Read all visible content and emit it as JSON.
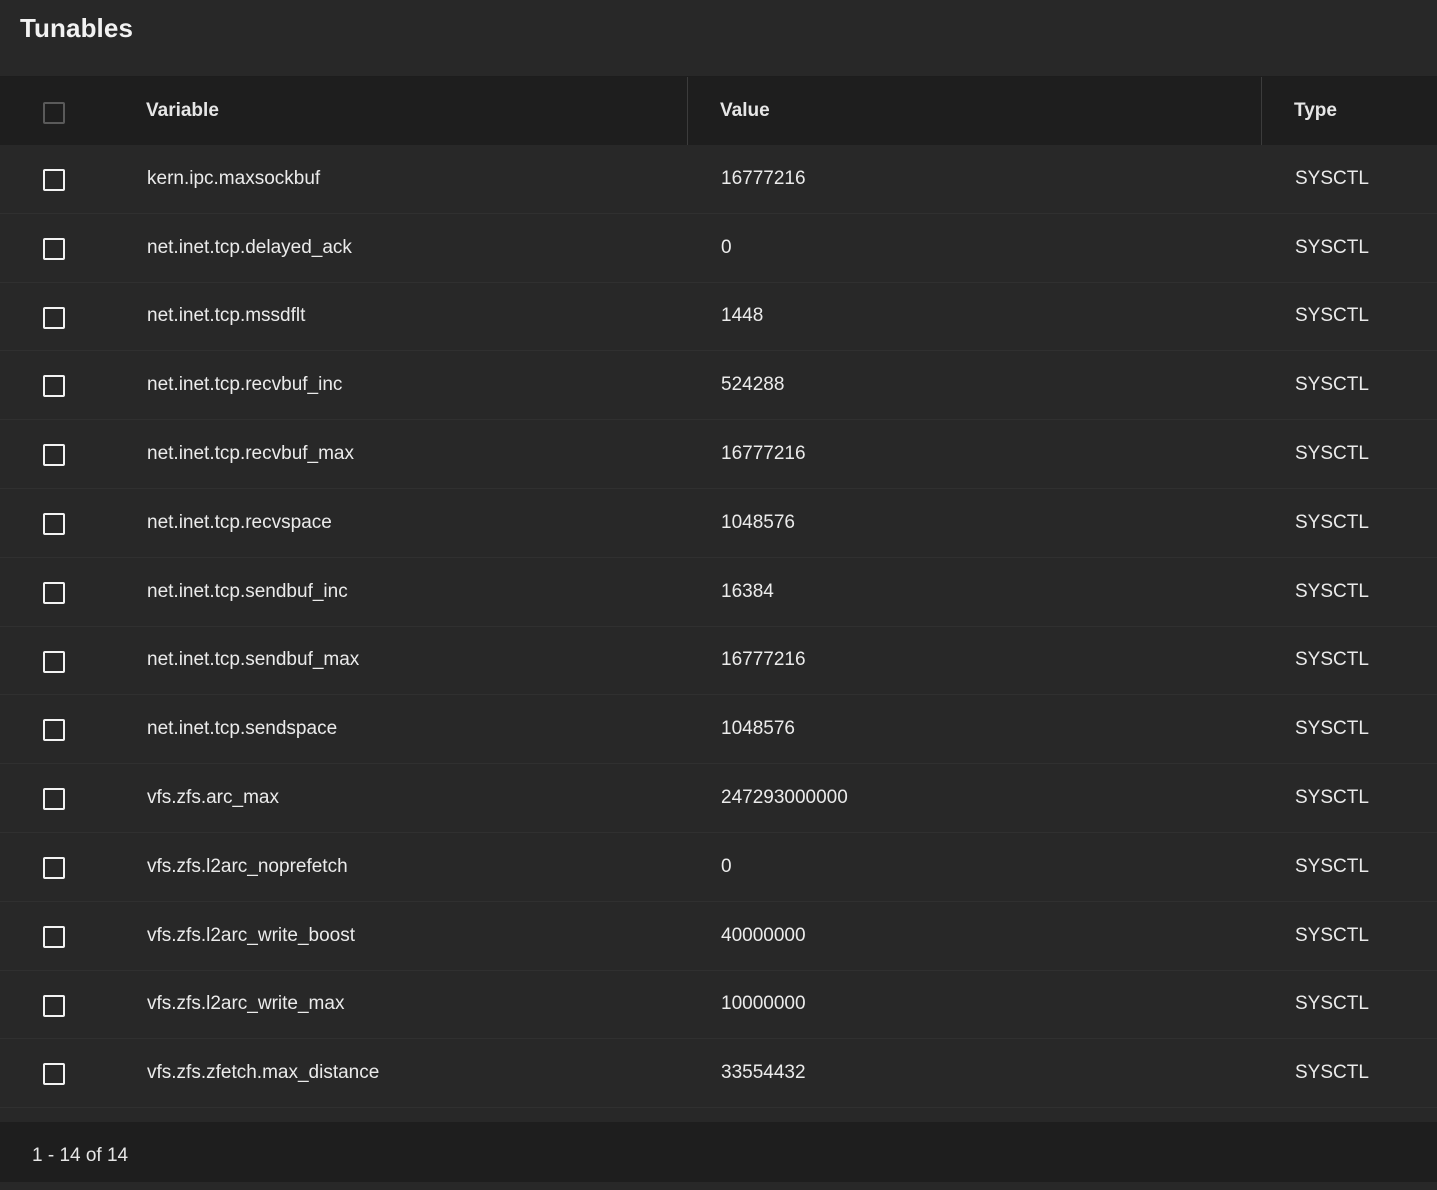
{
  "page": {
    "title": "Tunables"
  },
  "table": {
    "columns": [
      {
        "label": "Variable"
      },
      {
        "label": "Value"
      },
      {
        "label": "Type"
      }
    ],
    "rows": [
      {
        "variable": "kern.ipc.maxsockbuf",
        "value": "16777216",
        "type": "SYSCTL"
      },
      {
        "variable": "net.inet.tcp.delayed_ack",
        "value": "0",
        "type": "SYSCTL"
      },
      {
        "variable": "net.inet.tcp.mssdflt",
        "value": "1448",
        "type": "SYSCTL"
      },
      {
        "variable": "net.inet.tcp.recvbuf_inc",
        "value": "524288",
        "type": "SYSCTL"
      },
      {
        "variable": "net.inet.tcp.recvbuf_max",
        "value": "16777216",
        "type": "SYSCTL"
      },
      {
        "variable": "net.inet.tcp.recvspace",
        "value": "1048576",
        "type": "SYSCTL"
      },
      {
        "variable": "net.inet.tcp.sendbuf_inc",
        "value": "16384",
        "type": "SYSCTL"
      },
      {
        "variable": "net.inet.tcp.sendbuf_max",
        "value": "16777216",
        "type": "SYSCTL"
      },
      {
        "variable": "net.inet.tcp.sendspace",
        "value": "1048576",
        "type": "SYSCTL"
      },
      {
        "variable": "vfs.zfs.arc_max",
        "value": "247293000000",
        "type": "SYSCTL"
      },
      {
        "variable": "vfs.zfs.l2arc_noprefetch",
        "value": "0",
        "type": "SYSCTL"
      },
      {
        "variable": "vfs.zfs.l2arc_write_boost",
        "value": "40000000",
        "type": "SYSCTL"
      },
      {
        "variable": "vfs.zfs.l2arc_write_max",
        "value": "10000000",
        "type": "SYSCTL"
      },
      {
        "variable": "vfs.zfs.zfetch.max_distance",
        "value": "33554432",
        "type": "SYSCTL"
      }
    ]
  },
  "paginator": {
    "range_label": "1 - 14 of 14"
  },
  "colors": {
    "background": "#282828",
    "header_background": "#1e1e1e",
    "text": "#ebebeb"
  }
}
